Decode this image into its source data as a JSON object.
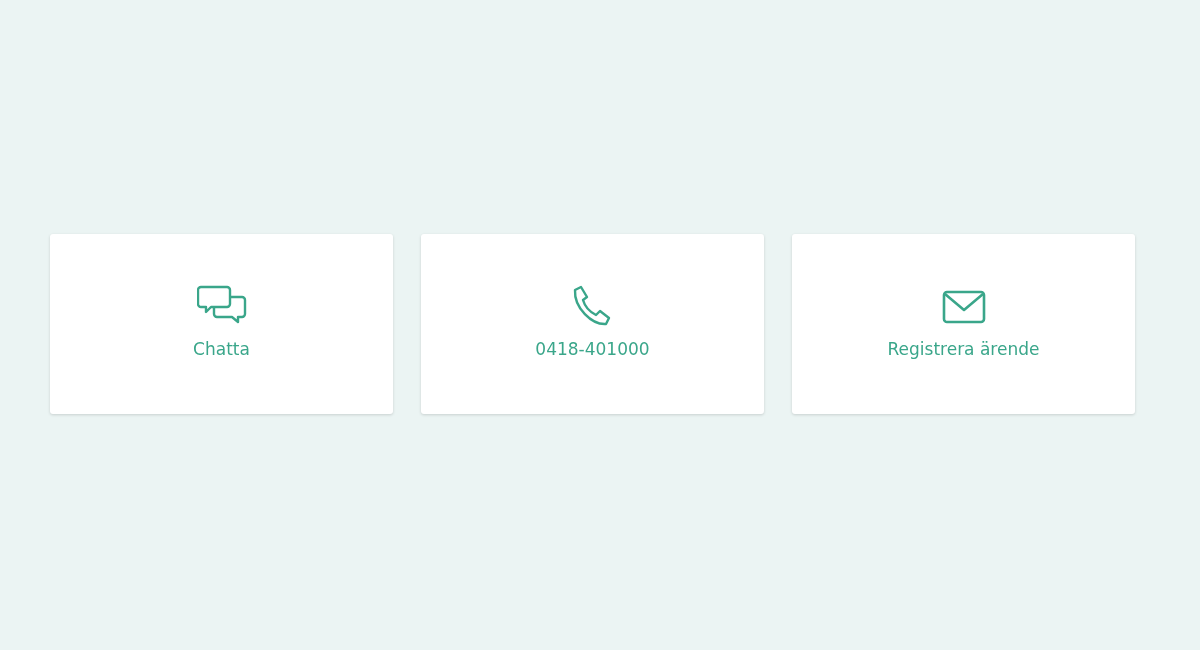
{
  "contact_options": [
    {
      "kind": "chat",
      "label": "Chatta"
    },
    {
      "kind": "phone",
      "label": "0418-401000"
    },
    {
      "kind": "mail",
      "label": "Registrera ärende"
    }
  ]
}
